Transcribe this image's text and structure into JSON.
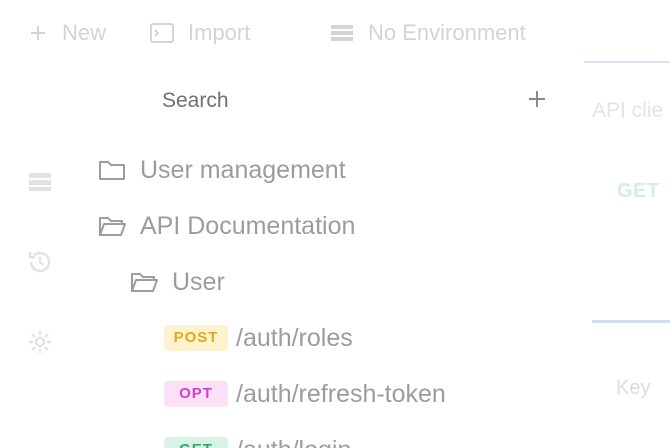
{
  "toolbar": {
    "new_label": "New",
    "import_label": "Import",
    "environment_label": "No Environment"
  },
  "search": {
    "placeholder": "Search"
  },
  "right_panel": {
    "api_text": "API clie",
    "method_text": "GET",
    "key_label": "Key"
  },
  "tree": {
    "folders": [
      {
        "label": "User management",
        "state": "closed"
      },
      {
        "label": "API Documentation",
        "state": "open"
      },
      {
        "label": "User",
        "state": "open"
      }
    ],
    "requests": [
      {
        "method": "POST",
        "path": "/auth/roles"
      },
      {
        "method": "OPT",
        "path": "/auth/refresh-token"
      },
      {
        "method": "GET",
        "path": "/auth/login"
      }
    ]
  },
  "colors": {
    "post": "#e7a812",
    "opt": "#d43fc9",
    "get": "#2fa874",
    "faded_text": "#d4d4d4",
    "tree_text": "#9c9c9c"
  },
  "icons": [
    "plus-icon",
    "terminal-icon",
    "environment-icon",
    "collections-icon",
    "history-icon",
    "gear-icon",
    "folder-icon",
    "folder-open-icon"
  ]
}
